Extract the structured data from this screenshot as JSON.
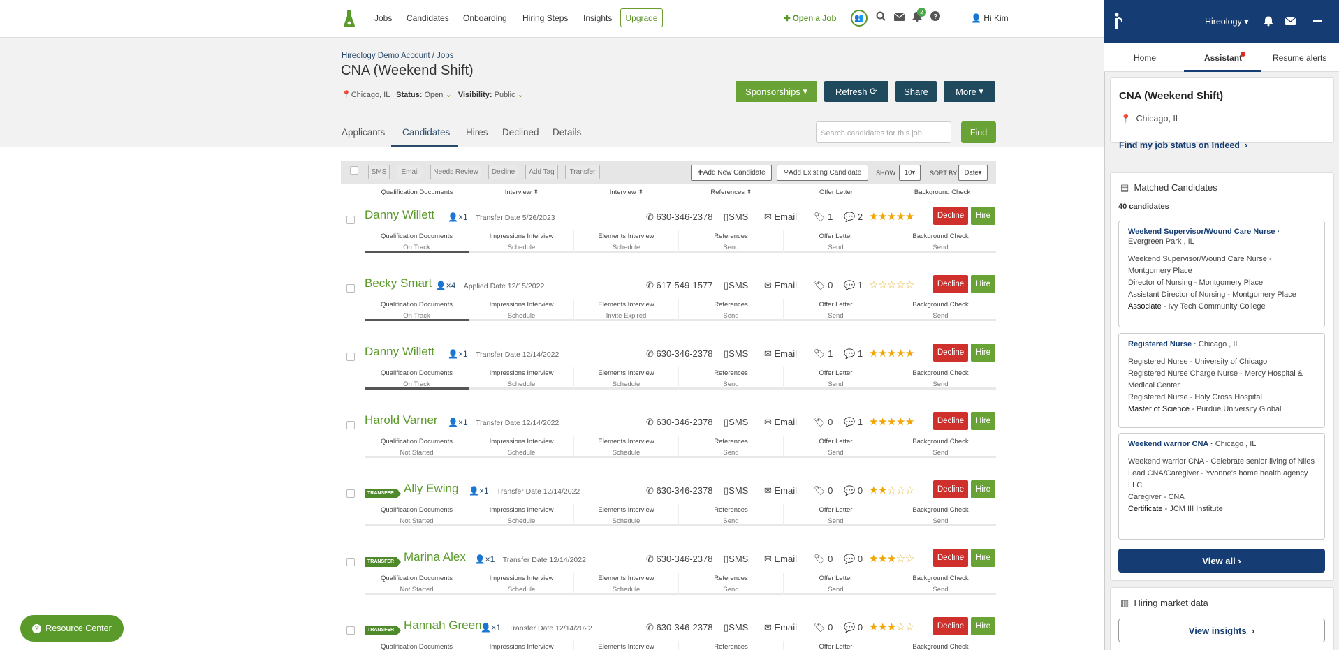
{
  "nav": {
    "links": [
      "Jobs",
      "Candidates",
      "Onboarding",
      "Hiring Steps",
      "Insights"
    ],
    "upgrade": "Upgrade",
    "open_job": "Open a Job",
    "notif_count": "2",
    "greeting": "Hi Kim"
  },
  "header": {
    "breadcrumb": "Hireology Demo Account / Jobs",
    "title": "CNA (Weekend Shift)",
    "location": "Chicago, IL",
    "status_label": "Status:",
    "status_value": "Open",
    "visibility_label": "Visibility:",
    "visibility_value": "Public",
    "buttons": {
      "sponsorships": "Sponsorships",
      "refresh": "Refresh",
      "share": "Share",
      "more": "More"
    }
  },
  "tabs": [
    "Applicants",
    "Candidates",
    "Hires",
    "Declined",
    "Details"
  ],
  "search": {
    "placeholder": "Search candidates for this job",
    "find": "Find"
  },
  "toolbar": {
    "actions": [
      "SMS",
      "Email",
      "Needs Review",
      "Decline",
      "Add Tag",
      "Transfer"
    ],
    "add_new": "Add New Candidate",
    "add_existing": "Add Existing Candidate",
    "show_label": "SHOW",
    "show_value": "10",
    "sort_label": "SORT BY",
    "sort_value": "Date"
  },
  "column_headers": [
    "Qualification Documents",
    "Interview",
    "Interview",
    "References",
    "Offer Letter",
    "Background Check"
  ],
  "step_names": [
    "Qualification Documents",
    "Impressions Interview",
    "Elements Interview",
    "References",
    "Offer Letter",
    "Background Check"
  ],
  "candidates": [
    {
      "name": "Danny Willett",
      "transfer": false,
      "count": "1",
      "date": "Transfer Date 5/26/2023",
      "phone": "630-346-2378",
      "sms": "SMS",
      "email": "Email",
      "tags": "1",
      "comments": "2",
      "rating": 5,
      "decline": "Decline",
      "hire": "Hire",
      "steps": [
        "On Track",
        "Schedule",
        "Schedule",
        "Send",
        "Send",
        "Send"
      ]
    },
    {
      "name": "Becky Smart",
      "transfer": false,
      "count": "4",
      "date": "Applied Date 12/15/2022",
      "phone": "617-549-1577",
      "sms": "SMS",
      "email": "Email",
      "tags": "0",
      "comments": "1",
      "rating": 0,
      "decline": "Decline",
      "hire": "Hire",
      "steps": [
        "On Track",
        "Schedule",
        "Invite Expired",
        "Send",
        "Send",
        "Send"
      ]
    },
    {
      "name": "Danny Willett",
      "transfer": false,
      "count": "1",
      "date": "Transfer Date 12/14/2022",
      "phone": "630-346-2378",
      "sms": "SMS",
      "email": "Email",
      "tags": "1",
      "comments": "1",
      "rating": 5,
      "decline": "Decline",
      "hire": "Hire",
      "steps": [
        "On Track",
        "Schedule",
        "Schedule",
        "Send",
        "Send",
        "Send"
      ]
    },
    {
      "name": "Harold Varner",
      "transfer": false,
      "count": "1",
      "date": "Transfer Date 12/14/2022",
      "phone": "630-346-2378",
      "sms": "SMS",
      "email": "Email",
      "tags": "0",
      "comments": "1",
      "rating": 5,
      "decline": "Decline",
      "hire": "Hire",
      "steps": [
        "Not Started",
        "Schedule",
        "Schedule",
        "Send",
        "Send",
        "Send"
      ]
    },
    {
      "name": "Ally Ewing",
      "transfer": true,
      "count": "1",
      "date": "Transfer Date 12/14/2022",
      "phone": "630-346-2378",
      "sms": "SMS",
      "email": "Email",
      "tags": "0",
      "comments": "0",
      "rating": 2,
      "decline": "Decline",
      "hire": "Hire",
      "steps": [
        "Not Started",
        "Schedule",
        "Schedule",
        "Send",
        "Send",
        "Send"
      ]
    },
    {
      "name": "Marina Alex",
      "transfer": true,
      "count": "1",
      "date": "Transfer Date 12/14/2022",
      "phone": "630-346-2378",
      "sms": "SMS",
      "email": "Email",
      "tags": "0",
      "comments": "0",
      "rating": 3,
      "decline": "Decline",
      "hire": "Hire",
      "steps": [
        "Not Started",
        "Schedule",
        "Schedule",
        "Send",
        "Send",
        "Send"
      ]
    },
    {
      "name": "Hannah Green",
      "transfer": true,
      "count": "1",
      "date": "Transfer Date 12/14/2022",
      "phone": "630-346-2378",
      "sms": "SMS",
      "email": "Email",
      "tags": "0",
      "comments": "0",
      "rating": 3,
      "decline": "Decline",
      "hire": "Hire",
      "steps": [
        "",
        "",
        "",
        "",
        "",
        ""
      ]
    }
  ],
  "transfer_tag": "TRANSFER",
  "resource_center": "Resource Center",
  "panel": {
    "org": "Hireology",
    "tabs": [
      "Home",
      "Assistant",
      "Resume alerts"
    ],
    "job_title": "CNA (Weekend Shift)",
    "job_location": "Chicago, IL",
    "indeed_link": "Find my job status on Indeed",
    "matched_title": "Matched Candidates",
    "matched_count": "40 candidates",
    "matches": [
      {
        "title": "Weekend Supervisor/Wound Care Nurse",
        "loc": "Evergreen Park , IL",
        "lines": [
          "Weekend Supervisor/Wound Care Nurse - Montgomery Place",
          "Director of Nursing - Montgomery Place",
          "Assistant Director of Nursing - Montgomery Place"
        ],
        "edu_deg": "Associate",
        "edu_school": "Ivy Tech Community College"
      },
      {
        "title": "Registered Nurse",
        "loc": "Chicago , IL",
        "lines": [
          "Registered Nurse - University of Chicago",
          "Registered Nurse Charge Nurse - Mercy Hospital & Medical Center",
          "Registered Nurse - Holy Cross Hospital"
        ],
        "edu_deg": "Master of Science",
        "edu_school": "Purdue University Global"
      },
      {
        "title": "Weekend warrior CNA",
        "loc": "Chicago , IL",
        "lines": [
          "Weekend warrior CNA - Celebrate senior living of Niles",
          "Lead CNA/Caregiver - Yvonne's home health agency LLC",
          "Caregiver - CNA"
        ],
        "edu_deg": "Certificate",
        "edu_school": "JCM III Institute"
      }
    ],
    "view_all": "View all",
    "market_title": "Hiring market data",
    "view_insights": "View insights"
  },
  "colors": {
    "green": "#5a9a2a",
    "navy": "#163d73",
    "red": "#d0302c",
    "dark": "#2a4a6a",
    "star": "#f0a500"
  }
}
